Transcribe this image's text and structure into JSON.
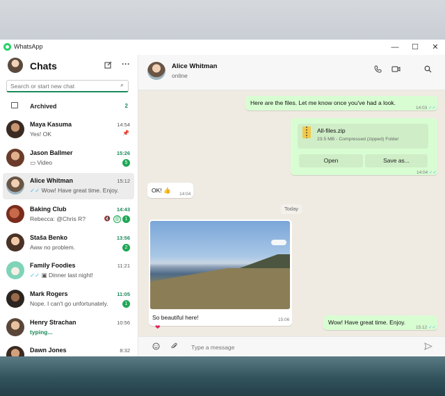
{
  "window": {
    "title": "WhatsApp",
    "controls": {
      "minimize": "—",
      "maximize": "☐",
      "close": "✕"
    }
  },
  "sidebar": {
    "title": "Chats",
    "new_chat_icon": "compose-icon",
    "menu_icon": "more-icon",
    "search_placeholder": "Search or start new chat",
    "archived": {
      "label": "Archived",
      "count": "2"
    },
    "chats": [
      {
        "name": "Maya Kasuma",
        "preview": "Yes! OK",
        "time": "14:54",
        "pinned": true
      },
      {
        "name": "Jason Ballmer",
        "preview": "Video",
        "time": "15:26",
        "unread": "5"
      },
      {
        "name": "Alice Whitman",
        "preview": "Wow! Have great time. Enjoy.",
        "time": "15:12",
        "active": true
      },
      {
        "name": "Baking Club",
        "preview": "Rebecca: @Chris R?",
        "time": "14:43",
        "unread": "1",
        "mention": "@",
        "muted": true
      },
      {
        "name": "Staša Benko",
        "preview": "Aww no problem.",
        "time": "13:56",
        "unread": "2"
      },
      {
        "name": "Family Foodies",
        "preview": "Dinner last night!",
        "time": "11:21"
      },
      {
        "name": "Mark Rogers",
        "preview": "Nope. I can't go unfortunately.",
        "time": "11:05",
        "unread": "1"
      },
      {
        "name": "Henry Strachan",
        "preview": "typing...",
        "time": "10:56"
      },
      {
        "name": "Dawn Jones",
        "preview": "",
        "time": "8:32"
      }
    ]
  },
  "conversation": {
    "contact_name": "Alice Whitman",
    "status": "online",
    "day_divider": "Today",
    "messages": [
      {
        "dir": "out",
        "text": "Here are the files. Let me know once you've had a look.",
        "time": "14:03"
      },
      {
        "dir": "out",
        "type": "file",
        "file_name": "All-files.zip",
        "file_meta": "23.5 MB - Compressed (zipped) Folder",
        "open_label": "Open",
        "save_label": "Save as...",
        "time": "14:04"
      },
      {
        "dir": "in",
        "text": "OK! 👍",
        "time": "14:04"
      },
      {
        "dir": "in",
        "type": "image",
        "caption": "So beautiful here!",
        "time": "15:06",
        "reaction": "❤"
      },
      {
        "dir": "out",
        "text": "Wow! Have great time. Enjoy.",
        "time": "15:12"
      }
    ],
    "composer_placeholder": "Type a message"
  },
  "colors": {
    "accent": "#1b8a5a",
    "outgoing_bubble": "#d9fdd3",
    "chat_bg": "#efeae2",
    "read_tick": "#53bdeb"
  }
}
